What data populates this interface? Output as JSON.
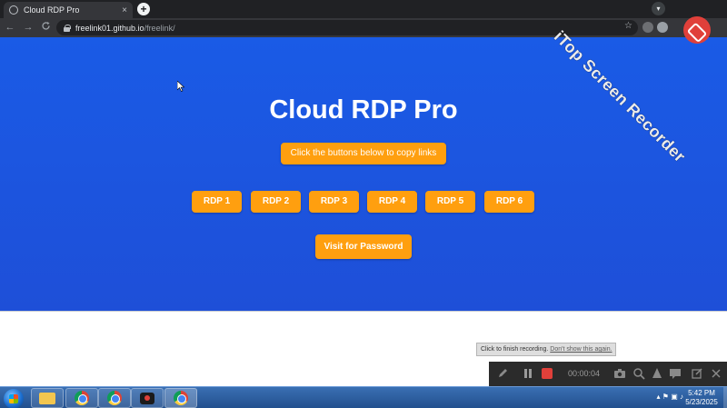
{
  "browser": {
    "tab_title": "Cloud RDP Pro",
    "tab_close": "×",
    "new_tab": "+",
    "url_host": "freelink01.github.io",
    "url_path": "/freelink/",
    "back": "←",
    "forward": "→",
    "reload": "C",
    "bookmark_star": "☆"
  },
  "page": {
    "title": "Cloud RDP Pro",
    "copy_hint": "Click the buttons below to copy links",
    "rdp_buttons": [
      "RDP 1",
      "RDP 2",
      "RDP 3",
      "RDP 4",
      "RDP 5",
      "RDP 6"
    ],
    "password_button": "Visit for Password"
  },
  "watermark": {
    "text": "iTop Screen Recorder"
  },
  "recorder": {
    "tip_text": "Click to finish recording.",
    "tip_link": "Don't show this again.",
    "timer": "00:00:04"
  },
  "taskbar": {
    "time": "5:42 PM",
    "date": "5/23/2025"
  },
  "colors": {
    "hero_blue": "#1a5be6",
    "button_orange": "#ff9f0f"
  }
}
